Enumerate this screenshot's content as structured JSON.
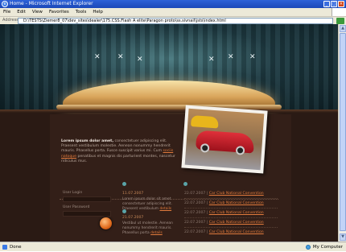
{
  "window": {
    "title": "Home - Microsoft Internet Explorer"
  },
  "menu": [
    "File",
    "Edit",
    "View",
    "Favorites",
    "Tools",
    "Help"
  ],
  "address": {
    "label": "Address",
    "url": "D:\\TESTS\\Ziemer8_07\\dev_sites\\dealer\\175.CSS.Flash A elite\\Paragon proto\\ss.sivnail\\jsts\\index.html"
  },
  "status": {
    "text": "Done",
    "zone": "My Computer"
  },
  "site": {
    "intro_bold": "Lorem ipsum dolor amet,",
    "intro_text": " consectetuer adipiscing elit. Praesent vestibulum molestie. Aenean nonummy hendrerit mauris. Phasellus porta. Fusce suscipit varius mi. Cum ",
    "intro_link": "sociis natoque",
    "intro_tail": " penatibus et magnis dis parturient montes, nascetur ridiculus mus.",
    "login": {
      "login_label": "User Login",
      "password_label": "User Password"
    },
    "news": [
      {
        "date": "11.07.2007",
        "text": "Lorem ipsum dolor sit amet consectetuer adipiscing elit. Praesent vestibulum",
        "link": "details"
      },
      {
        "date": "21.07.2007",
        "text": "Vestibul ut molestie. Aenean nonummy hendrerit mauris. Phasellus porta",
        "link": "details"
      }
    ],
    "events": [
      {
        "date": "22.07.2007",
        "sep": " | ",
        "title": "Car Club National Convention"
      },
      {
        "date": "22.07.2007",
        "sep": " | ",
        "title": "Car Club National Convention"
      },
      {
        "date": "22.07.2007",
        "sep": " | ",
        "title": "Car Club National Convention"
      },
      {
        "date": "22.07.2007",
        "sep": " | ",
        "title": "Car Club National Convention"
      },
      {
        "date": "22.07.2007",
        "sep": " | ",
        "title": "Car Club National Convention"
      }
    ]
  },
  "icons": {
    "stars": "star-icon",
    "logo": "ie-logo-icon"
  },
  "colors": {
    "accent": "#e07a3c",
    "background": "#2a1a14",
    "teal": "#5aa4a8"
  }
}
